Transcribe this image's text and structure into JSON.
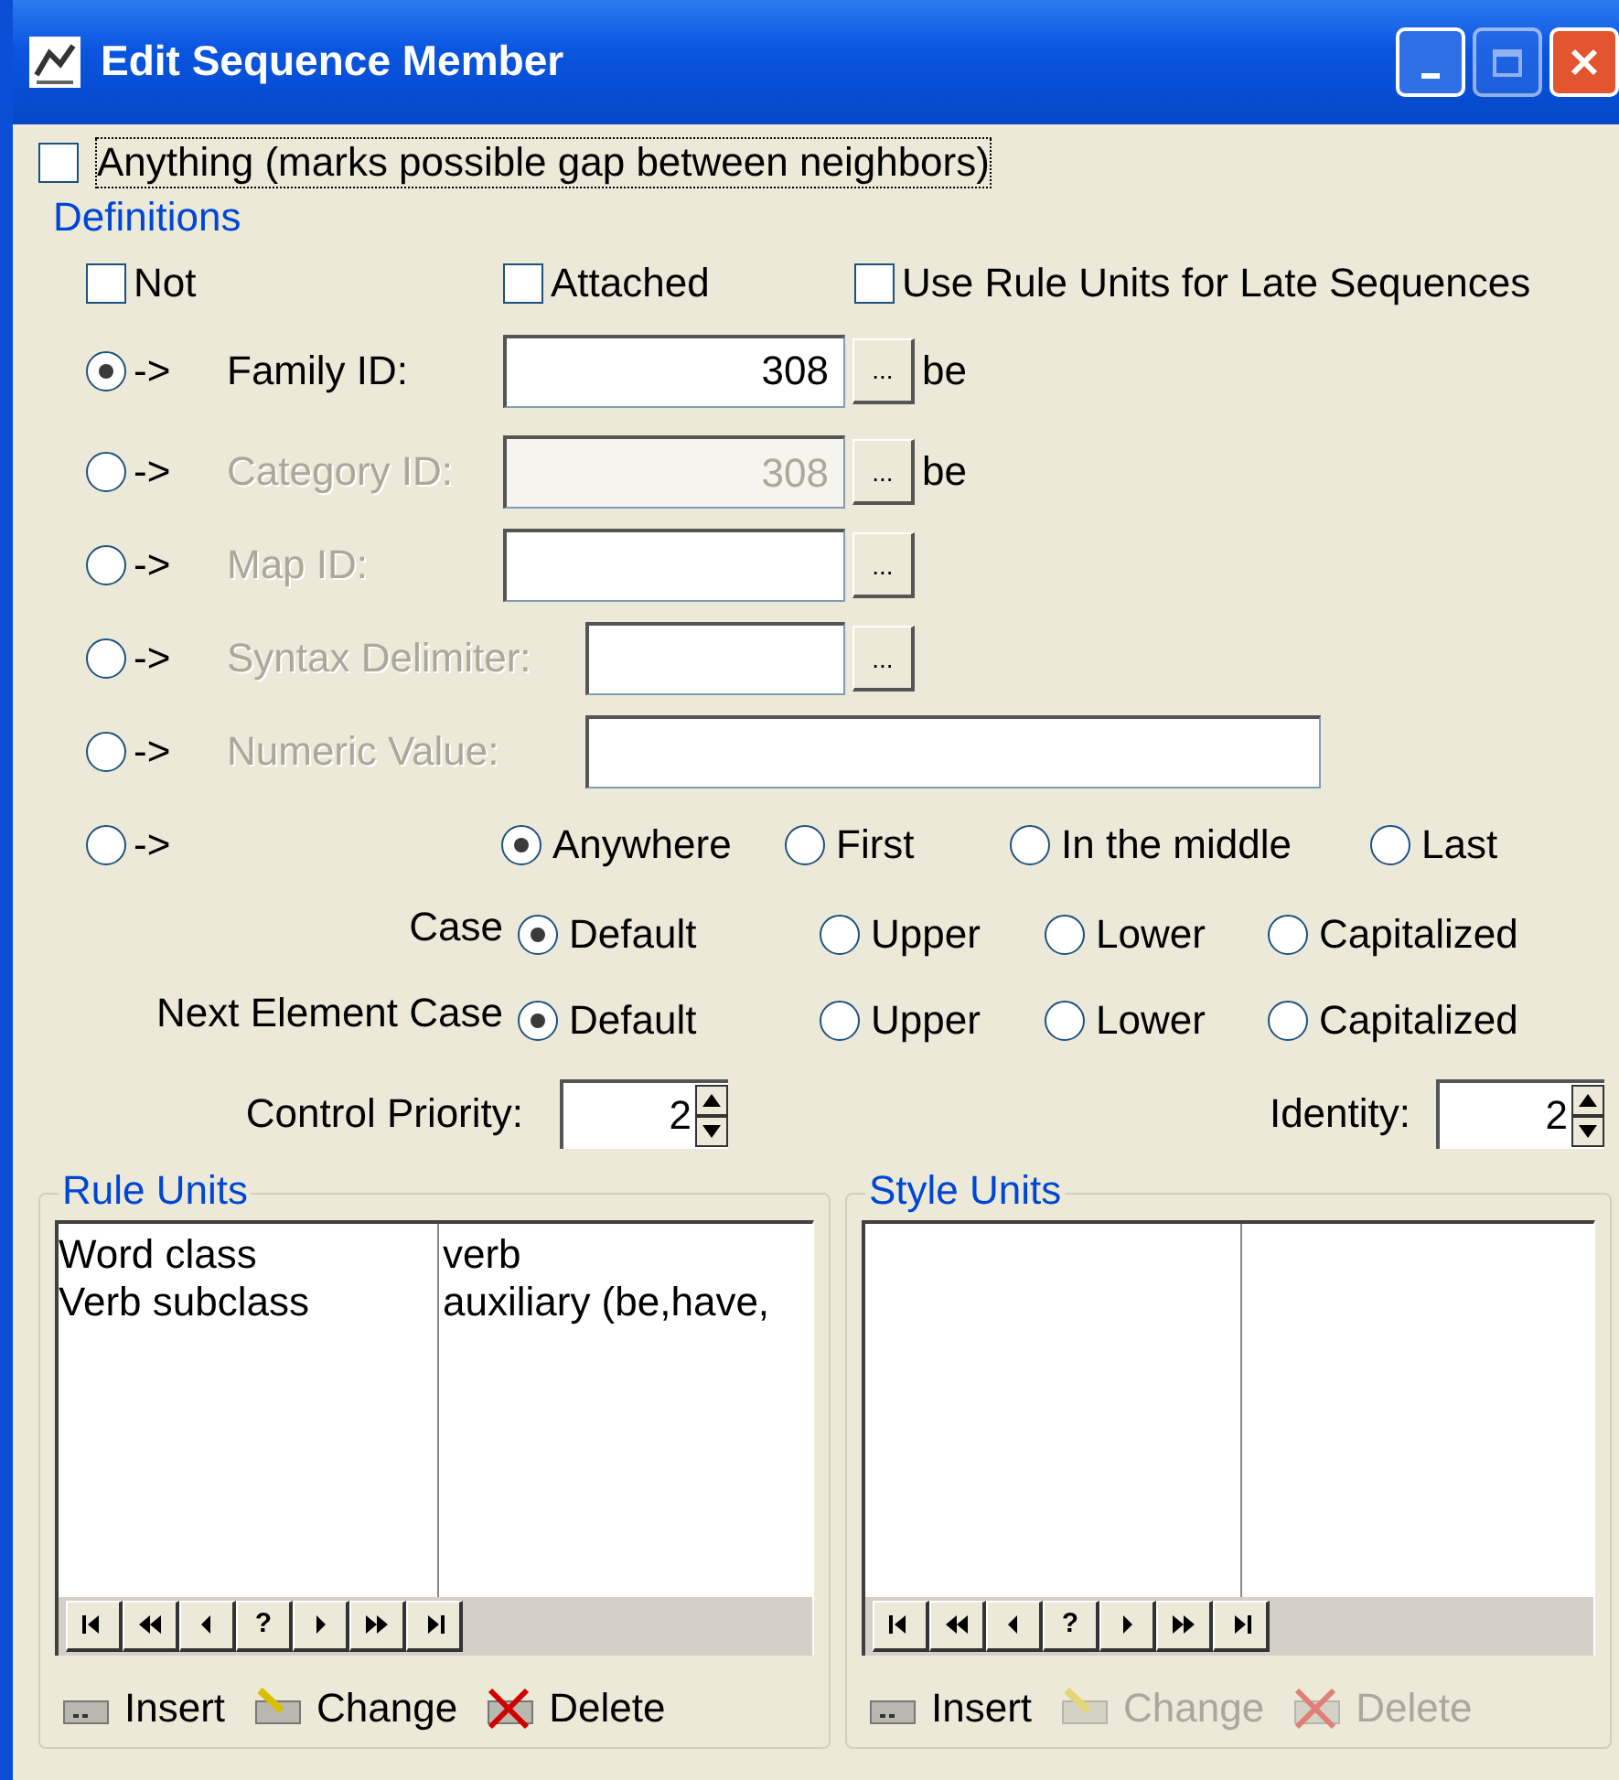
{
  "window": {
    "title": "Edit Sequence Member",
    "buttons": [
      {
        "kind": "minimize",
        "disabled": false
      },
      {
        "kind": "maximize",
        "disabled": true
      },
      {
        "kind": "close",
        "disabled": false
      }
    ]
  },
  "anything": {
    "label": "Anything (marks possible gap between neighbors)",
    "checked": false,
    "focused": true
  },
  "definitions": {
    "title": "Definitions",
    "flags": [
      {
        "label": "Not",
        "checked": false
      },
      {
        "label": "Attached",
        "checked": false
      },
      {
        "label": "Use Rule Units for Late Sequences",
        "checked": false
      }
    ],
    "sources": [
      {
        "kind": "field",
        "arrow": "->",
        "label": "Family ID:",
        "selected": true,
        "disabled": false,
        "value": "308",
        "field_disabled": false,
        "browse": "...",
        "suffix": "be"
      },
      {
        "kind": "field",
        "arrow": "->",
        "label": "Category ID:",
        "selected": false,
        "disabled": true,
        "value": "308",
        "field_disabled": true,
        "browse": "...",
        "suffix": "be"
      },
      {
        "kind": "field",
        "arrow": "->",
        "label": "Map ID:",
        "selected": false,
        "disabled": true,
        "field_disabled": false,
        "browse": "..."
      },
      {
        "kind": "short-field",
        "arrow": "->",
        "label": "Syntax Delimiter:",
        "selected": false,
        "disabled": true,
        "field_disabled": false,
        "browse": "..."
      },
      {
        "kind": "long-field",
        "arrow": "->",
        "label": "Numeric Value:",
        "selected": false,
        "disabled": true,
        "field_disabled": false
      },
      {
        "kind": "position",
        "arrow": "->",
        "selected": false,
        "options": [
          {
            "label": "Anywhere",
            "selected": true
          },
          {
            "label": "First",
            "selected": false
          },
          {
            "label": "In the middle",
            "selected": false
          },
          {
            "label": "Last",
            "selected": false
          }
        ]
      }
    ],
    "case_rows": [
      {
        "label": "Case",
        "options": [
          {
            "label": "Default",
            "selected": true
          },
          {
            "label": "Upper",
            "selected": false
          },
          {
            "label": "Lower",
            "selected": false
          },
          {
            "label": "Capitalized",
            "selected": false
          }
        ]
      },
      {
        "label": "Next Element Case",
        "options": [
          {
            "label": "Default",
            "selected": true
          },
          {
            "label": "Upper",
            "selected": false
          },
          {
            "label": "Lower",
            "selected": false
          },
          {
            "label": "Capitalized",
            "selected": false
          }
        ]
      }
    ],
    "control_priority": {
      "label": "Control Priority:",
      "value": "2"
    },
    "identity": {
      "label": "Identity:",
      "value": "2"
    }
  },
  "panels": [
    {
      "title": "Rule Units",
      "rows": [
        {
          "name": "Word class",
          "value": "verb"
        },
        {
          "name": "Verb subclass",
          "value": "auxiliary (be,have,"
        }
      ],
      "nav": [
        {
          "kind": "first"
        },
        {
          "kind": "prev-page"
        },
        {
          "kind": "prev"
        },
        {
          "kind": "help",
          "label": "?"
        },
        {
          "kind": "next"
        },
        {
          "kind": "next-page"
        },
        {
          "kind": "last"
        }
      ],
      "actions": [
        {
          "kind": "insert",
          "label": "Insert",
          "disabled": false
        },
        {
          "kind": "change",
          "label": "Change",
          "disabled": false
        },
        {
          "kind": "delete",
          "label": "Delete",
          "disabled": false
        }
      ]
    },
    {
      "title": "Style Units",
      "nav": [
        {
          "kind": "first"
        },
        {
          "kind": "prev-page"
        },
        {
          "kind": "prev"
        },
        {
          "kind": "help",
          "label": "?"
        },
        {
          "kind": "next"
        },
        {
          "kind": "next-page"
        },
        {
          "kind": "last"
        }
      ],
      "actions": [
        {
          "kind": "insert",
          "label": "Insert",
          "disabled": false
        },
        {
          "kind": "change",
          "label": "Change",
          "disabled": true
        },
        {
          "kind": "delete",
          "label": "Delete",
          "disabled": true
        }
      ]
    }
  ]
}
